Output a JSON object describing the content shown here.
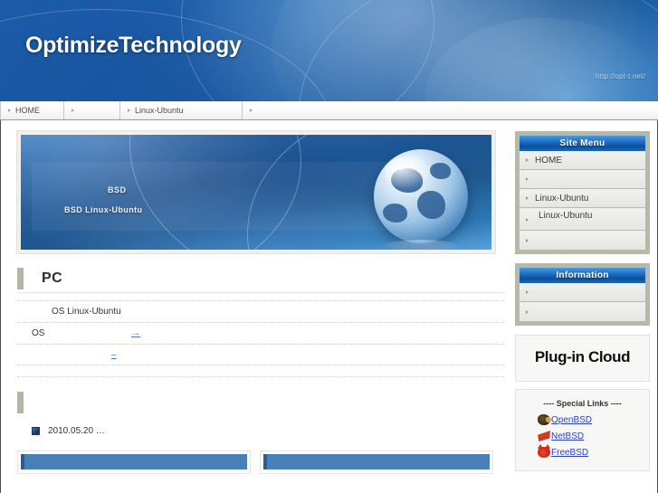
{
  "header": {
    "site_title": "OptimizeTechnology",
    "site_url": "http://opt-t.net/"
  },
  "global_nav": {
    "items": [
      {
        "label": "HOME"
      },
      {
        "label": ""
      },
      {
        "label": "Linux-Ubuntu"
      },
      {
        "label": ""
      }
    ]
  },
  "main": {
    "banner": {
      "line1": "BSD",
      "line2": "BSD  Linux-Ubuntu"
    },
    "sections": [
      {
        "title": "PC"
      },
      {
        "title": ""
      }
    ],
    "spec_rows": [
      {
        "term": "",
        "desc": "OS Linux-Ubuntu",
        "link": ""
      },
      {
        "term": "OS",
        "desc": "",
        "link": "→"
      },
      {
        "term": "",
        "desc": "",
        "link": "–"
      }
    ],
    "news": [
      {
        "date": "2010.05.20 …"
      }
    ],
    "boxes": [
      {
        "title": ""
      },
      {
        "title": ""
      }
    ]
  },
  "sidebar": {
    "site_menu": {
      "title": "Site Menu",
      "items": [
        {
          "label": "HOME"
        },
        {
          "label": ""
        },
        {
          "label": "Linux-Ubuntu"
        },
        {
          "label": "Linux-Ubuntu"
        },
        {
          "label": ""
        }
      ]
    },
    "information": {
      "title": "Information",
      "items": [
        {
          "label": ""
        },
        {
          "label": ""
        }
      ]
    },
    "plugin": {
      "title": "Plug-in Cloud"
    },
    "special_links": {
      "title": "---- Special Links ----",
      "links": [
        {
          "label": "OpenBSD",
          "icon": "openbsd-puffer-icon"
        },
        {
          "label": "NetBSD",
          "icon": "netbsd-flag-icon"
        },
        {
          "label": "FreeBSD",
          "icon": "freebsd-daemon-icon"
        }
      ]
    }
  },
  "colors": {
    "header_blue": "#1b5ba8",
    "panel_head_blue": "#1c6fc4",
    "accent_khaki": "#b5b5a3",
    "link_blue": "#2b3fc8",
    "body_link_blue": "#4a76b8",
    "box_blue": "#4a80b8"
  }
}
